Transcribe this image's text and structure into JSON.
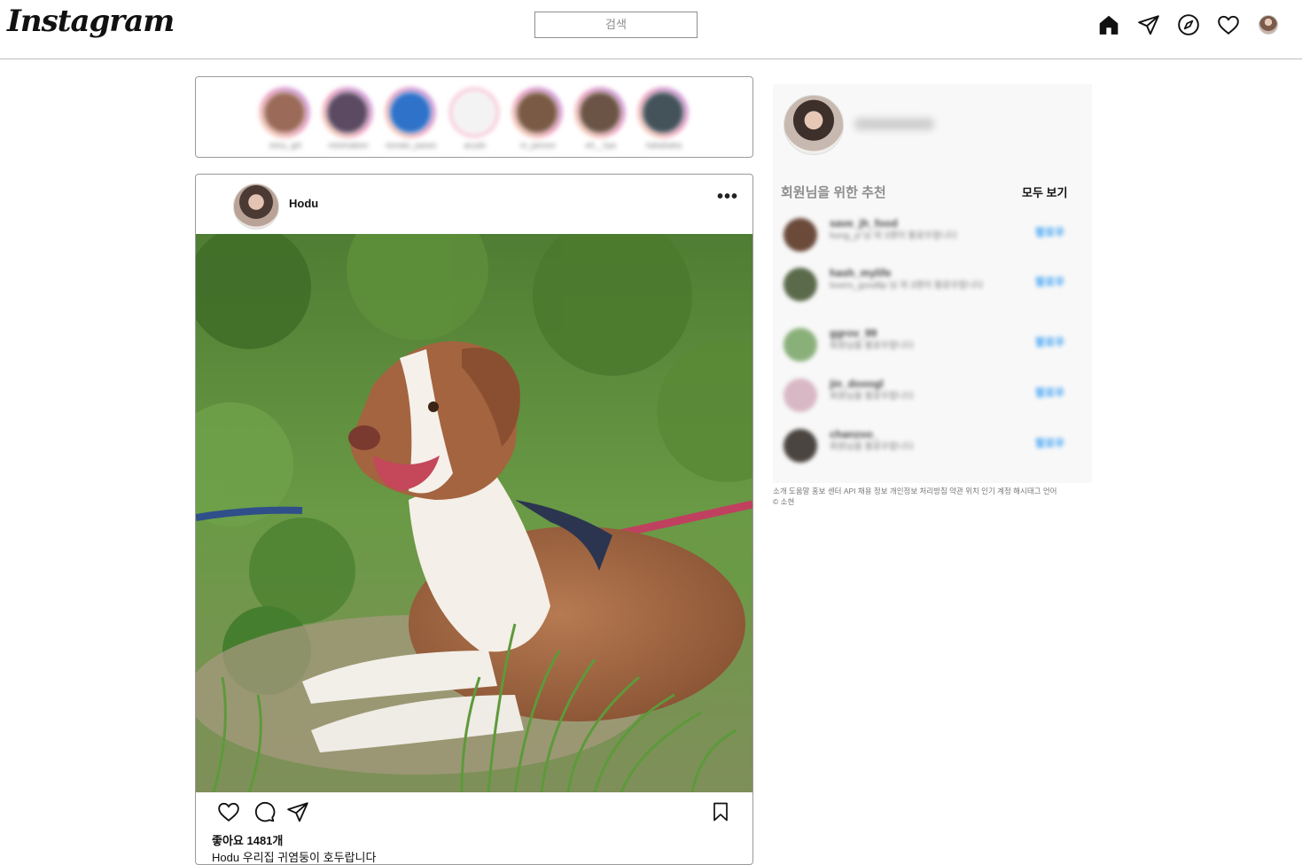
{
  "header": {
    "logo": "Instagram",
    "search_placeholder": "검색",
    "icons": [
      "home-icon",
      "send-icon",
      "explore-icon",
      "heart-icon",
      "profile-avatar"
    ]
  },
  "stories": [
    {
      "name": "story_girl",
      "color": "#9b6a58"
    },
    {
      "name": "minimalism",
      "color": "#5b4a62"
    },
    {
      "name": "tomato_panes",
      "color": "#2f72c9"
    },
    {
      "name": "acrylic",
      "color": "#f3f3f3"
    },
    {
      "name": "m_person",
      "color": "#7a5a45"
    },
    {
      "name": "eh__hye",
      "color": "#6b5445"
    },
    {
      "name": "hahahaha",
      "color": "#44525a"
    }
  ],
  "post": {
    "username": "Hodu",
    "more_label": "•••",
    "likes": "좋아요 1481개",
    "caption": "Hodu       우리집 귀염둥이   호두랍니다"
  },
  "sidebar": {
    "recommend_title": "회원님을 위한 추천",
    "see_all": "모두 보기",
    "recommendations": [
      {
        "username": "save_jh_food",
        "subtitle": "hong_yl 님 외 3명이 팔로우합니다",
        "follow": "팔로우",
        "color": "#6b4a3a"
      },
      {
        "username": "hash_mylife",
        "subtitle": "lovers_goodlip 님 외 3명이 팔로우합니다",
        "follow": "팔로우",
        "color": "#5a6a4a"
      },
      {
        "username": "ggrov_99",
        "subtitle": "회원님을 팔로우합니다",
        "follow": "팔로우",
        "color": "#8ab07a"
      },
      {
        "username": "jin_dooogl",
        "subtitle": "회원님을 팔로우합니다",
        "follow": "팔로우",
        "color": "#d9b8c6"
      },
      {
        "username": "chanzoo_",
        "subtitle": "회원님을 팔로우합니다",
        "follow": "팔로우",
        "color": "#4a4540"
      }
    ]
  },
  "footer": {
    "links": "소개 도움말 홍보 센터 API 채용 정보 개인정보 처리방침 약관 위치 인기 계정 해시태그 언어",
    "copyright": "© 소현"
  }
}
